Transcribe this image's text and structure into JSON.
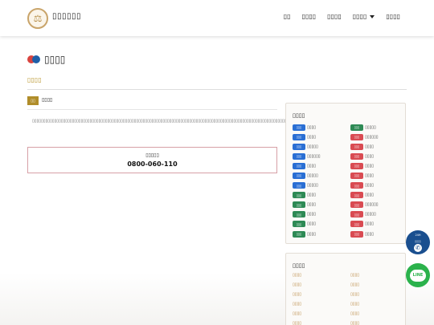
{
  "header": {
    "brand": "▯▯▯▯▯▯",
    "logo_icon": "scales-icon",
    "nav": [
      {
        "label": "▯▯",
        "dropdown": false
      },
      {
        "label": "▯▯▯▯",
        "dropdown": false
      },
      {
        "label": "▯▯▯▯",
        "dropdown": false
      },
      {
        "label": "▯▯▯▯",
        "dropdown": true
      },
      {
        "label": "▯▯▯▯",
        "dropdown": false
      }
    ]
  },
  "page": {
    "title": "▯▯▯▯",
    "breadcrumb": "▯▯▯▯"
  },
  "main": {
    "tag": "▯▯",
    "tag_label": "▯▯▯▯",
    "paragraph": "▯▯▯▯▯▯▯▯▯▯▯▯▯▯▯▯▯▯▯▯▯▯▯▯▯▯▯▯▯▯▯▯▯▯▯▯▯▯▯▯▯▯▯▯▯▯▯▯▯▯▯▯▯▯▯▯▯▯▯▯▯▯▯▯▯▯▯▯▯▯▯▯▯▯▯▯▯▯▯▯▯▯▯▯▯▯▯▯▯▯▯▯▯▯▯▯▯▯▯▯▯▯▯▯▯▯▯▯▯▯▯▯▯▯▯▯▯▯▯▯▯▯▯▯▯▯▯▯▯▯▯▯▯▯▯▯▯▯▯▯▯▯▯▯▯▯▯",
    "phone_label": "▯▯▯▯▯",
    "phone_number": "0800-060-110"
  },
  "sidebar": {
    "categories_title": "▯▯▯▯",
    "categories": [
      {
        "badge": "▯▯▯",
        "color": "blue",
        "text": "▯▯▯▯"
      },
      {
        "badge": "▯▯▯",
        "color": "green",
        "text": "▯▯▯▯▯"
      },
      {
        "badge": "▯▯▯",
        "color": "blue",
        "text": "▯▯▯▯"
      },
      {
        "badge": "▯▯▯",
        "color": "red",
        "text": "▯▯▯▯▯▯"
      },
      {
        "badge": "▯▯▯",
        "color": "blue",
        "text": "▯▯▯▯▯"
      },
      {
        "badge": "▯▯▯",
        "color": "red",
        "text": "▯▯▯▯"
      },
      {
        "badge": "▯▯▯",
        "color": "blue",
        "text": "▯▯▯▯▯▯"
      },
      {
        "badge": "▯▯▯",
        "color": "red",
        "text": "▯▯▯▯"
      },
      {
        "badge": "▯▯▯",
        "color": "blue",
        "text": "▯▯▯▯"
      },
      {
        "badge": "▯▯▯",
        "color": "red",
        "text": "▯▯▯▯"
      },
      {
        "badge": "▯▯▯",
        "color": "blue",
        "text": "▯▯▯▯▯"
      },
      {
        "badge": "▯▯▯",
        "color": "red",
        "text": "▯▯▯▯"
      },
      {
        "badge": "▯▯▯",
        "color": "blue",
        "text": "▯▯▯▯▯"
      },
      {
        "badge": "▯▯▯",
        "color": "red",
        "text": "▯▯▯▯"
      },
      {
        "badge": "▯▯▯",
        "color": "green",
        "text": "▯▯▯▯"
      },
      {
        "badge": "▯▯▯",
        "color": "red",
        "text": "▯▯▯▯"
      },
      {
        "badge": "▯▯▯",
        "color": "green",
        "text": "▯▯▯▯"
      },
      {
        "badge": "▯▯▯",
        "color": "red",
        "text": "▯▯▯▯▯▯"
      },
      {
        "badge": "▯▯▯",
        "color": "green",
        "text": "▯▯▯▯"
      },
      {
        "badge": "▯▯▯",
        "color": "red",
        "text": "▯▯▯▯▯"
      },
      {
        "badge": "▯▯▯",
        "color": "green",
        "text": "▯▯▯▯"
      },
      {
        "badge": "▯▯▯",
        "color": "red",
        "text": "▯▯▯▯"
      },
      {
        "badge": "▯▯▯",
        "color": "green",
        "text": "▯▯▯▯"
      },
      {
        "badge": "▯▯▯",
        "color": "red",
        "text": "▯▯▯▯"
      }
    ],
    "links_title": "▯▯▯▯",
    "links": [
      "▯▯▯▯",
      "▯▯▯▯",
      "▯▯▯▯",
      "▯▯▯▯",
      "▯▯▯▯",
      "▯▯▯▯",
      "▯▯▯▯",
      "▯▯▯▯",
      "▯▯▯▯",
      "▯▯▯▯",
      "▯▯▯▯",
      "▯▯▯▯"
    ]
  },
  "floating": {
    "phone_caption": "24H",
    "phone_subcaption": "▯▯▯▯",
    "phone_icon": "phone-icon",
    "line_label": "LINE"
  },
  "colors": {
    "accent_gold": "#b89428",
    "badge_blue": "#2a6fd4",
    "badge_green": "#2e8a55",
    "badge_red": "#d94b52",
    "phone_blue": "#1a4f8f",
    "line_green": "#2bb24c"
  }
}
